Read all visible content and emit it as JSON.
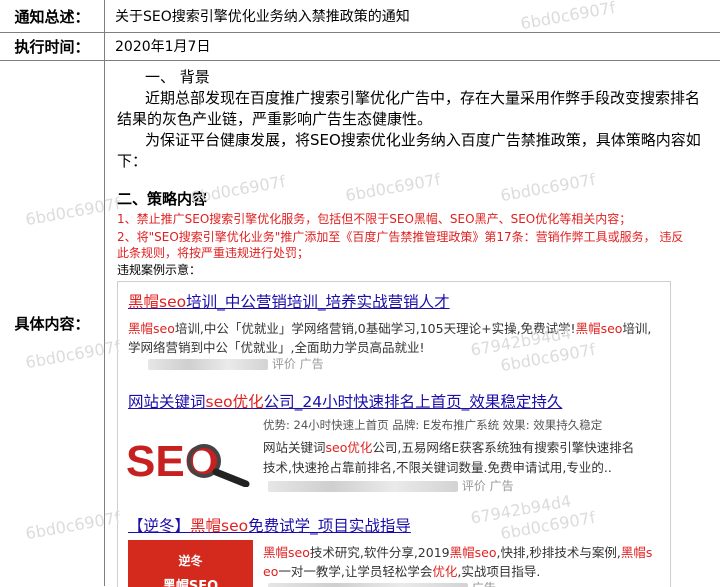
{
  "rows": {
    "summary": {
      "label": "通知总述：",
      "value": "关于SEO搜索引擎优化业务纳入禁推政策的通知"
    },
    "date": {
      "label": "执行时间：",
      "value": "2020年1月7日"
    },
    "content_label": "具体内容："
  },
  "content": {
    "h1": "一、 背景",
    "bg_line1": "近期总部发现在百度推广搜索引擎优化广告中，存在大量采用作弊手段改变搜索排名",
    "bg_line2": "结果的灰色产业链，严重影响广告生态健康性。",
    "bg_line3": "为保证平台健康发展，将SEO搜索优化业务纳入百度广告禁推政策，具体策略内容如",
    "bg_line4": "下：",
    "h2": "二、策略内容",
    "rule1": "1、禁止推广SEO搜索引擎优化服务，包括但不限于SEO黑帽、SEO黑产、SEO优化等相关内容；",
    "rule2_line1": "2、将\"SEO搜索引擎优化业务\"推广添加至《百度广告禁推管理政策》第17条：营销作弊工具或服务， 违反",
    "rule2_line2": "此条规则，将按严重违规进行处罚；",
    "example_label": "违规案例示意："
  },
  "ads": [
    {
      "title_parts": [
        "黑帽seo",
        "培训_中公营销培训_培养实战营销人才"
      ],
      "desc1_parts": [
        "黑帽seo",
        "培训,中公「优就业」学网络营销,0基础学习,105天理论+实操,免费试学!",
        "黑帽seo",
        "培训,"
      ],
      "desc2": "学网络营销到中公「优就业」,全面助力学员高品就业!",
      "meta_eval": "评价",
      "meta_ad": "广告"
    },
    {
      "title_parts": [
        "网站关键词",
        "seo优化",
        "公司_24小时快速排名上首页_效果稳定持久"
      ],
      "features": "优势: 24小时快速上首页      品牌: E发布推广系统      效果: 效果持久稳定",
      "desc1_parts": [
        "网站关键词",
        "seo优化",
        "公司,五易网络E获客系统独有搜索引擎快速排名"
      ],
      "desc2": "技术,快速抢占靠前排名,不限关键词数量.免费申请试用,专业的..",
      "meta_eval": "评价",
      "meta_ad": "广告",
      "logo_text": "SEO"
    },
    {
      "title_parts": [
        "【逆冬】",
        "黑帽seo",
        "免费试学_项目实战指导"
      ],
      "desc1_parts": [
        "黑帽seo",
        "技术研究,软件分享,2019",
        "黑帽seo",
        ",快排,秒排技术与案例,",
        "黑帽s"
      ],
      "desc2_parts": [
        "eo",
        "一对一教学,让学员轻松学会",
        "优化",
        ",实战项目指导."
      ],
      "thumb_line1": "逆冬",
      "thumb_line2": "黑帽SEO",
      "meta_ad": "广告"
    }
  ],
  "watermark": "6bd0c6907f",
  "watermark_alt": "67942b94d4",
  "colors": {
    "link": "#1a0dab",
    "highlight": "#e02020",
    "border": "#7f7f7f"
  }
}
